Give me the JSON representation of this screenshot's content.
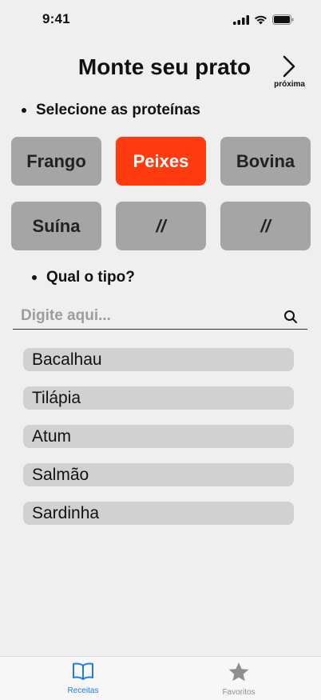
{
  "status": {
    "time": "9:41"
  },
  "header": {
    "title": "Monte seu prato",
    "next_label": "próxima"
  },
  "proteins": {
    "section_title": "Selecione as proteínas",
    "items": [
      "Frango",
      "Peixes",
      "Bovina",
      "Suína",
      "//",
      "//"
    ],
    "selected": "Peixes"
  },
  "type_section": {
    "title": "Qual o tipo?"
  },
  "search": {
    "placeholder": "Digite aqui...",
    "value": ""
  },
  "fish_list": [
    "Bacalhau",
    "Tilápia",
    "Atum",
    "Salmão",
    "Sardinha"
  ],
  "tabs": [
    {
      "label": "Receitas",
      "icon": "book-icon",
      "active": true
    },
    {
      "label": "Favoritos",
      "icon": "star-icon",
      "active": false
    }
  ],
  "colors": {
    "accent": "#ff3b0f",
    "tab_active": "#1e7cf0",
    "button_gray": "#a5a5a5",
    "list_item": "#d1d1d1"
  }
}
